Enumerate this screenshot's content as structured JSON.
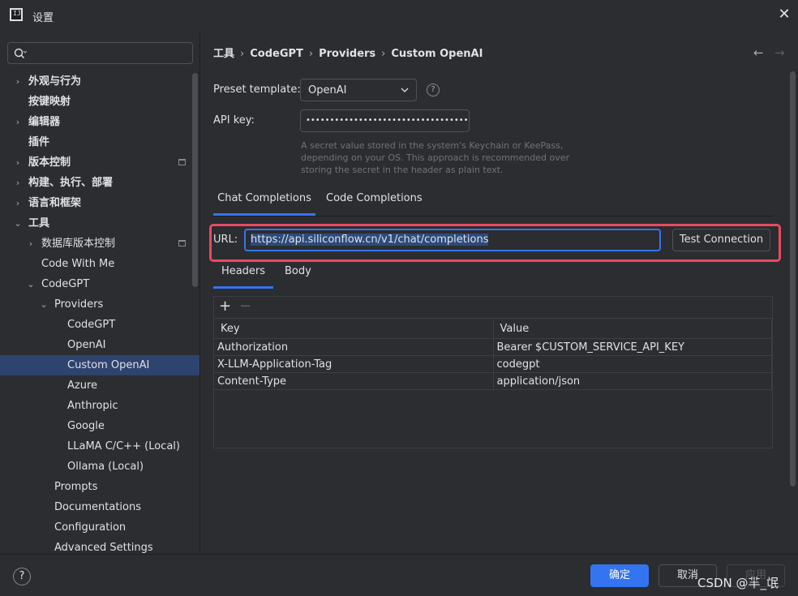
{
  "window": {
    "title": "设置",
    "app_icon_text": "IJ"
  },
  "search": {
    "placeholder": "",
    "value": ""
  },
  "sidebar": {
    "items": [
      {
        "label": "外观与行为",
        "bold": true,
        "arrow": "›",
        "level": 0
      },
      {
        "label": "按键映射",
        "bold": true,
        "arrow": "",
        "level": 0
      },
      {
        "label": "编辑器",
        "bold": true,
        "arrow": "›",
        "level": 0
      },
      {
        "label": "插件",
        "bold": true,
        "arrow": "",
        "level": 0
      },
      {
        "label": "版本控制",
        "bold": true,
        "arrow": "›",
        "level": 0,
        "project_icon": true
      },
      {
        "label": "构建、执行、部署",
        "bold": true,
        "arrow": "›",
        "level": 0
      },
      {
        "label": "语言和框架",
        "bold": true,
        "arrow": "›",
        "level": 0
      },
      {
        "label": "工具",
        "bold": true,
        "arrow": "⌄",
        "level": 0
      },
      {
        "label": "数据库版本控制",
        "bold": false,
        "arrow": "›",
        "level": 1,
        "project_icon": true
      },
      {
        "label": "Code With Me",
        "bold": false,
        "arrow": "",
        "level": 1
      },
      {
        "label": "CodeGPT",
        "bold": false,
        "arrow": "⌄",
        "level": 1
      },
      {
        "label": "Providers",
        "bold": false,
        "arrow": "⌄",
        "level": 2
      },
      {
        "label": "CodeGPT",
        "bold": false,
        "arrow": "",
        "level": 3
      },
      {
        "label": "OpenAI",
        "bold": false,
        "arrow": "",
        "level": 3
      },
      {
        "label": "Custom OpenAI",
        "bold": false,
        "arrow": "",
        "level": 3,
        "selected": true
      },
      {
        "label": "Azure",
        "bold": false,
        "arrow": "",
        "level": 3
      },
      {
        "label": "Anthropic",
        "bold": false,
        "arrow": "",
        "level": 3
      },
      {
        "label": "Google",
        "bold": false,
        "arrow": "",
        "level": 3
      },
      {
        "label": "LLaMA C/C++ (Local)",
        "bold": false,
        "arrow": "",
        "level": 3
      },
      {
        "label": "Ollama (Local)",
        "bold": false,
        "arrow": "",
        "level": 3
      },
      {
        "label": "Prompts",
        "bold": false,
        "arrow": "",
        "level": 2
      },
      {
        "label": "Documentations",
        "bold": false,
        "arrow": "",
        "level": 2
      },
      {
        "label": "Configuration",
        "bold": false,
        "arrow": "",
        "level": 2
      },
      {
        "label": "Advanced Settings",
        "bold": false,
        "arrow": "",
        "level": 2
      }
    ]
  },
  "breadcrumb": [
    "工具",
    "CodeGPT",
    "Providers",
    "Custom OpenAI"
  ],
  "form": {
    "preset_label": "Preset template:",
    "preset_value": "OpenAI",
    "apikey_label": "API key:",
    "apikey_value": "••••••••••••••••••••••••••••••••••••••••••",
    "hint": "A secret value stored in the system's Keychain or KeePass, depending on your OS. This approach is recommended over storing the secret in the header as plain text."
  },
  "tabs": {
    "chat": "Chat Completions",
    "code": "Code Completions"
  },
  "url": {
    "label": "URL:",
    "value": "https://api.siliconflow.cn/v1/chat/completions",
    "test_button": "Test Connection"
  },
  "subtabs": {
    "headers": "Headers",
    "body": "Body"
  },
  "headers_table": {
    "add": "+",
    "remove": "−",
    "columns": [
      "Key",
      "Value"
    ],
    "rows": [
      [
        "Authorization",
        "Bearer $CUSTOM_SERVICE_API_KEY"
      ],
      [
        "X-LLM-Application-Tag",
        "codegpt"
      ],
      [
        "Content-Type",
        "application/json"
      ]
    ]
  },
  "footer": {
    "help": "?",
    "ok": "确定",
    "cancel": "取消",
    "apply": "应用",
    "watermark": "CSDN @羋_氓"
  },
  "colors": {
    "accent": "#3574f0",
    "highlight": "#e84a5f",
    "selected_bg": "#2e436e",
    "bg": "#2b2d30"
  }
}
